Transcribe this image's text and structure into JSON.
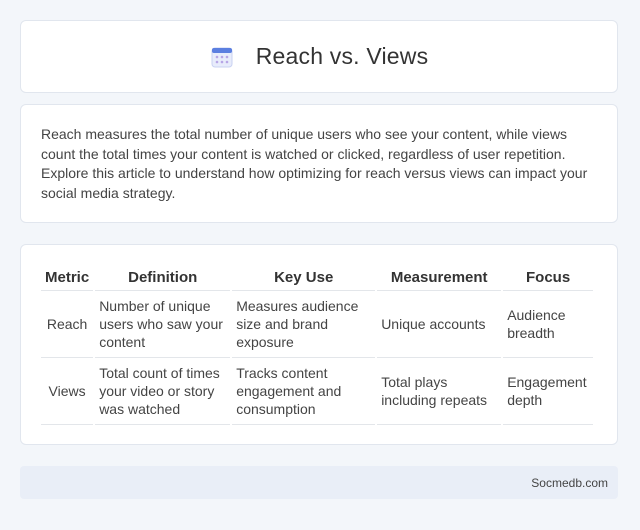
{
  "header": {
    "title": "Reach vs. Views",
    "icon": "calendar-icon"
  },
  "intro": {
    "text": "Reach measures the total number of unique users who see your content, while views count the total times your content is watched or clicked, regardless of user repetition. Explore this article to understand how optimizing for reach versus views can impact your social media strategy."
  },
  "table": {
    "headers": [
      "Metric",
      "Definition",
      "Key Use",
      "Measurement",
      "Focus"
    ],
    "rows": [
      [
        "Reach",
        "Number of unique users who saw your content",
        "Measures audience size and brand exposure",
        "Unique accounts",
        "Audience breadth"
      ],
      [
        "Views",
        "Total count of times your video or story was watched",
        "Tracks content engagement and consumption",
        "Total plays including repeats",
        "Engagement depth"
      ]
    ]
  },
  "footer": {
    "source": "Socmedb.com"
  },
  "colors": {
    "background": "#f3f6fa",
    "footer_bg": "#e9eef7",
    "icon_accent": "#5b7fe0"
  }
}
